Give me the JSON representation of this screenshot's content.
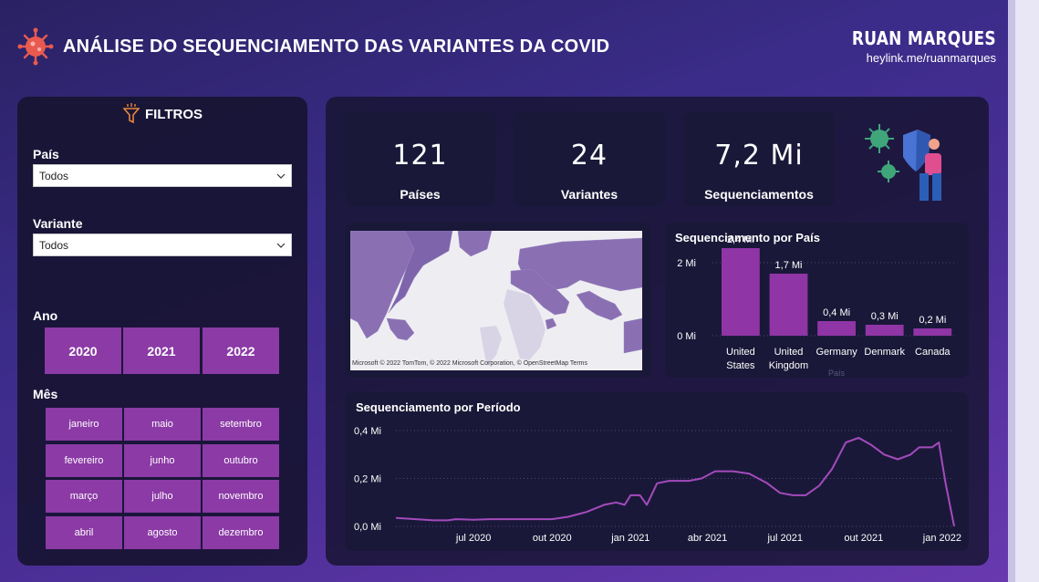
{
  "header": {
    "title": "ANÁLISE DO SEQUENCIAMENTO DAS VARIANTES DA COVID",
    "author_name": "RUAN MARQUES",
    "author_link": "heylink.me/ruanmarques"
  },
  "filters": {
    "title": "FILTROS",
    "country_label": "País",
    "country_value": "Todos",
    "variant_label": "Variante",
    "variant_value": "Todos",
    "year_label": "Ano",
    "years": [
      "2020",
      "2021",
      "2022"
    ],
    "month_label": "Mês",
    "months": [
      "janeiro",
      "maio",
      "setembro",
      "fevereiro",
      "junho",
      "outubro",
      "março",
      "julho",
      "novembro",
      "abril",
      "agosto",
      "dezembro"
    ]
  },
  "kpis": [
    {
      "value": "121",
      "label": "Países"
    },
    {
      "value": "24",
      "label": "Variantes"
    },
    {
      "value": "7,2 Mi",
      "label": "Sequenciamentos"
    }
  ],
  "map": {
    "credit": "Microsoft  © 2022 TomTom, © 2022 Microsoft Corporation, © OpenStreetMap  Terms"
  },
  "colors": {
    "accent": "#8b3aa6",
    "bar": "#8f35a6",
    "line": "#a34bbd",
    "map_country": "#8a70b3"
  },
  "chart_data": [
    {
      "type": "bar",
      "title": "Sequenciamento por País",
      "xlabel": "País",
      "ylabel": "",
      "categories": [
        "United States",
        "United Kingdom",
        "Germany",
        "Denmark",
        "Canada"
      ],
      "category_lines": [
        [
          "United",
          "States"
        ],
        [
          "United",
          "Kingdom"
        ],
        [
          "Germany"
        ],
        [
          "Denmark"
        ],
        [
          "Canada"
        ]
      ],
      "values": [
        2.4,
        1.7,
        0.4,
        0.3,
        0.2
      ],
      "data_labels": [
        "2,4 Mi",
        "1,7 Mi",
        "0,4 Mi",
        "0,3 Mi",
        "0,2 Mi"
      ],
      "yticks": [
        "0 Mi",
        "2 Mi"
      ],
      "ytick_values": [
        0,
        2
      ],
      "ylim": [
        0,
        2.5
      ],
      "grid": true
    },
    {
      "type": "line",
      "title": "Sequenciamento por Período",
      "xlabel": "",
      "ylabel": "",
      "x": [
        "2020-04",
        "2020-05",
        "2020-06",
        "2020-07",
        "2020-08",
        "2020-09",
        "2020-10",
        "2020-11",
        "2020-12",
        "2021-01",
        "2021-02",
        "2021-03",
        "2021-04",
        "2021-05",
        "2021-06",
        "2021-07",
        "2021-08",
        "2021-09",
        "2021-10",
        "2021-11",
        "2021-12",
        "2022-01"
      ],
      "series": [
        {
          "values": [
            0.03,
            0.02,
            0.025,
            0.03,
            0.03,
            0.035,
            0.05,
            0.07,
            0.1,
            0.12,
            0.14,
            0.19,
            0.2,
            0.23,
            0.2,
            0.14,
            0.13,
            0.16,
            0.22,
            0.36,
            0.3,
            0.0
          ]
        }
      ],
      "points": [
        [
          "2020-04-01",
          0.035
        ],
        [
          "2020-05-15",
          0.025
        ],
        [
          "2020-06-01",
          0.025
        ],
        [
          "2020-06-10",
          0.03
        ],
        [
          "2020-07-01",
          0.028
        ],
        [
          "2020-07-20",
          0.03
        ],
        [
          "2020-08-15",
          0.03
        ],
        [
          "2020-09-15",
          0.03
        ],
        [
          "2020-10-01",
          0.03
        ],
        [
          "2020-10-20",
          0.04
        ],
        [
          "2020-11-10",
          0.06
        ],
        [
          "2020-12-01",
          0.09
        ],
        [
          "2020-12-15",
          0.1
        ],
        [
          "2020-12-25",
          0.09
        ],
        [
          "2021-01-01",
          0.13
        ],
        [
          "2021-01-12",
          0.13
        ],
        [
          "2021-01-20",
          0.09
        ],
        [
          "2021-02-01",
          0.18
        ],
        [
          "2021-02-15",
          0.19
        ],
        [
          "2021-03-10",
          0.19
        ],
        [
          "2021-03-25",
          0.2
        ],
        [
          "2021-04-10",
          0.23
        ],
        [
          "2021-05-01",
          0.23
        ],
        [
          "2021-05-20",
          0.22
        ],
        [
          "2021-06-10",
          0.18
        ],
        [
          "2021-06-25",
          0.14
        ],
        [
          "2021-07-10",
          0.13
        ],
        [
          "2021-07-25",
          0.13
        ],
        [
          "2021-08-10",
          0.17
        ],
        [
          "2021-08-25",
          0.24
        ],
        [
          "2021-09-10",
          0.35
        ],
        [
          "2021-09-25",
          0.37
        ],
        [
          "2021-10-10",
          0.34
        ],
        [
          "2021-10-25",
          0.3
        ],
        [
          "2021-11-10",
          0.28
        ],
        [
          "2021-11-25",
          0.3
        ],
        [
          "2021-12-05",
          0.33
        ],
        [
          "2021-12-20",
          0.33
        ],
        [
          "2021-12-28",
          0.35
        ],
        [
          "2022-01-05",
          0.18
        ],
        [
          "2022-01-15",
          0.0
        ]
      ],
      "xticks": [
        "jul 2020",
        "out 2020",
        "jan 2021",
        "abr 2021",
        "jul 2021",
        "out 2021",
        "jan 2022"
      ],
      "xtick_dates": [
        "2020-07-01",
        "2020-10-01",
        "2021-01-01",
        "2021-04-01",
        "2021-07-01",
        "2021-10-01",
        "2022-01-01"
      ],
      "yticks": [
        "0,0 Mi",
        "0,2 Mi",
        "0,4 Mi"
      ],
      "ytick_values": [
        0,
        0.2,
        0.4
      ],
      "ylim": [
        0,
        0.4
      ],
      "grid": true
    }
  ]
}
